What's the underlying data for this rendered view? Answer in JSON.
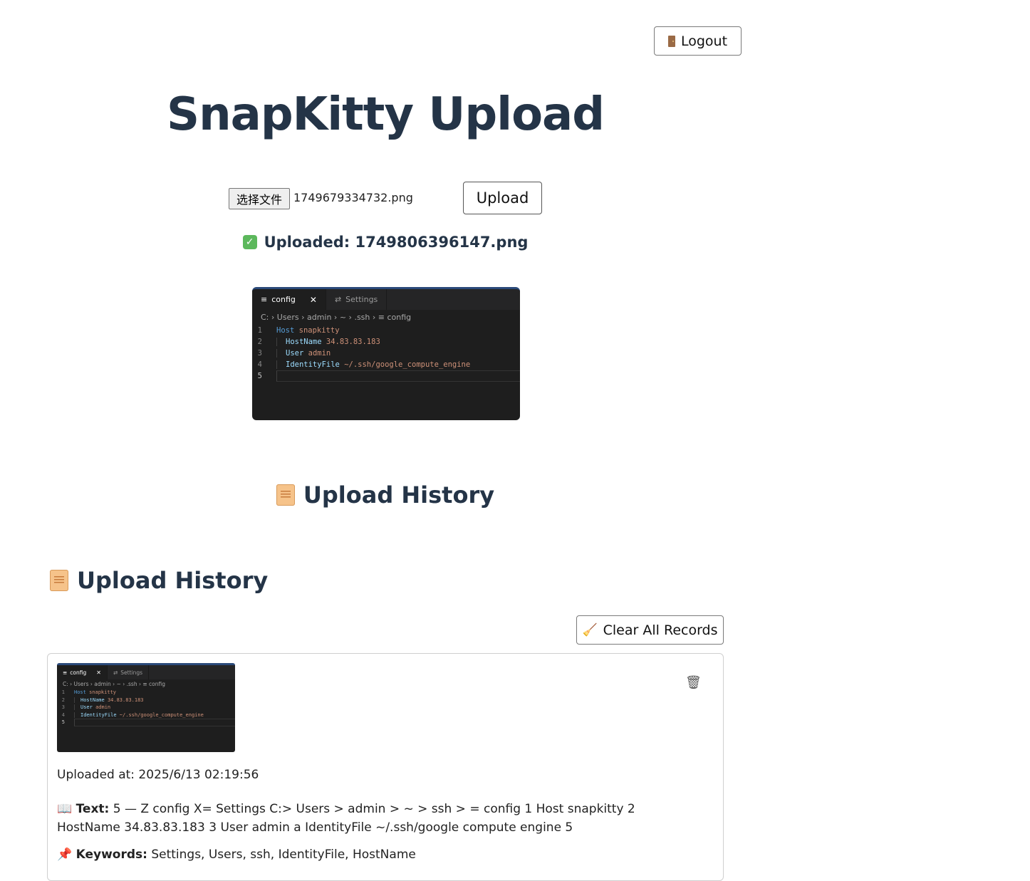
{
  "header": {
    "logout_label": "Logout",
    "logout_icon": "door-icon"
  },
  "title": "SnapKitty Upload",
  "upload_form": {
    "choose_file_label": "选择文件",
    "selected_file": "1749679334732.png",
    "upload_label": "Upload"
  },
  "status": {
    "icon": "check-icon",
    "text": "Uploaded: 1749806396147.png"
  },
  "preview": {
    "tabs": [
      {
        "label": "config",
        "close": "✕"
      },
      {
        "label": "Settings"
      }
    ],
    "breadcrumb": "C: › Users › admin › ~ › .ssh › ≡ config",
    "lines": [
      {
        "n": "1",
        "kw": "Host",
        "val": "snapkitty"
      },
      {
        "n": "2",
        "kw": "HostName",
        "val": "34.83.83.183"
      },
      {
        "n": "3",
        "kw": "User",
        "val": "admin"
      },
      {
        "n": "4",
        "kw": "IdentityFile",
        "val": "~/.ssh/google_compute_engine"
      },
      {
        "n": "5",
        "kw": "",
        "val": ""
      }
    ]
  },
  "history_center": {
    "icon": "scroll-icon",
    "title": "Upload History"
  },
  "history": {
    "icon": "scroll-icon",
    "title": "Upload History",
    "clear_label": "Clear All Records",
    "clear_icon": "broom-icon",
    "records": [
      {
        "uploaded_at": "Uploaded at: 2025/6/13 02:19:56",
        "text_label": "Text:",
        "text_value": "5 — Z config X= Settings C:> Users > admin > ~ > ssh > = config 1 Host snapkitty 2 HostName 34.83.83.183 3 User admin a IdentityFile ~/.ssh/google compute engine 5",
        "keywords_label": "Keywords:",
        "keywords_value": "Settings, Users, ssh, IdentityFile, HostName",
        "delete_icon": "trash-icon"
      }
    ]
  }
}
